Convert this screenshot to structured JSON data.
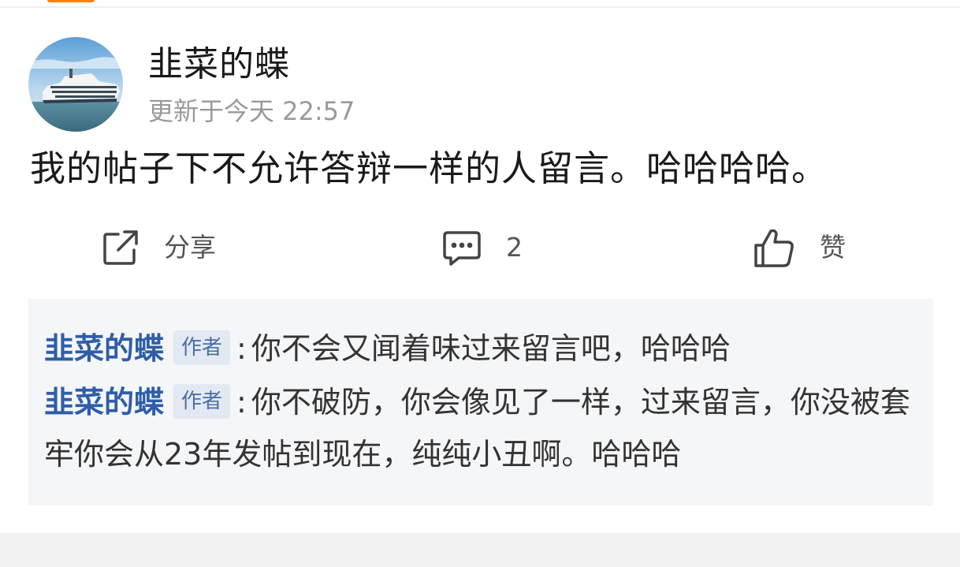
{
  "post": {
    "username": "韭菜的蝶",
    "timestamp": "更新于今天 22:57",
    "content": "我的帖子下不允许答辩一样的人留言。哈哈哈哈。"
  },
  "actions": {
    "share_label": "分享",
    "comment_count": "2",
    "like_label": "赞"
  },
  "comments": [
    {
      "author": "韭菜的蝶",
      "badge": "作者",
      "separator": ":",
      "text": "你不会又闻着味过来留言吧，哈哈哈"
    },
    {
      "author": "韭菜的蝶",
      "badge": "作者",
      "separator": ":",
      "text": "你不破防，你会像见了一样，过来留言，你没被套牢你会从23年发帖到现在，纯纯小丑啊。哈哈哈"
    }
  ],
  "colors": {
    "accent": "#ff8200",
    "author_link": "#2f5ea8",
    "badge_bg": "#e3e9f2",
    "panel_bg": "#f5f6f8"
  },
  "icons": {
    "share": "share-icon",
    "comment": "comment-icon",
    "like": "thumbs-up-icon"
  }
}
